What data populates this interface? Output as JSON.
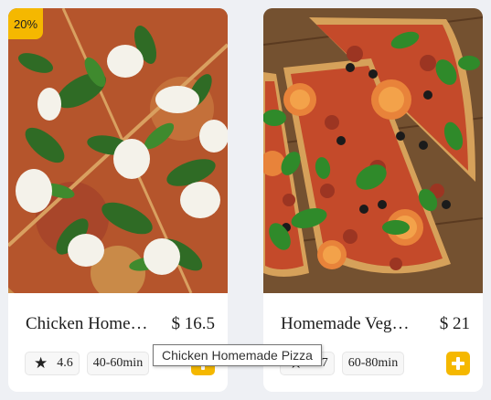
{
  "cards": [
    {
      "discount": "20%",
      "title": "Chicken Homemade Pizza",
      "price": "$ 16.5",
      "rating": "4.6",
      "time": "40-60min",
      "image": "spinach-mozzarella-pizza",
      "icons": {
        "rating": "star-icon",
        "add": "plus-icon"
      }
    },
    {
      "title": "Homemade Veggie Pizza",
      "price": "$ 21",
      "rating": "4.7",
      "time": "60-80min",
      "image": "tomato-basil-olive-pizza",
      "icons": {
        "rating": "star-icon",
        "add": "plus-icon"
      }
    }
  ],
  "tooltip": "Chicken Homemade Pizza",
  "colors": {
    "accent": "#f5b800",
    "background": "#eef0f4",
    "card": "#ffffff"
  }
}
